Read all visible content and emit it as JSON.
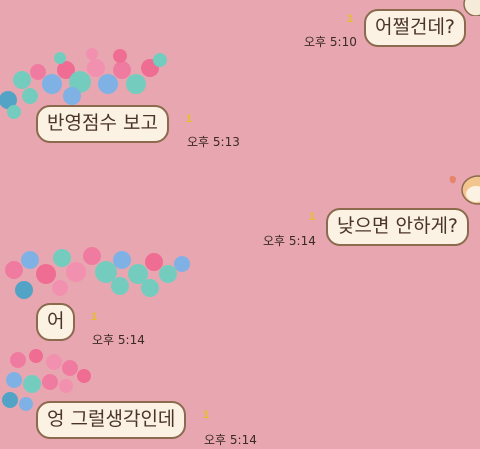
{
  "colors": {
    "background": "#e8a7b0",
    "bubble_fill": "#fbf2e4",
    "bubble_border": "#8b6a4e",
    "unread_count": "#e3c01f"
  },
  "messages": [
    {
      "side": "right",
      "text": "어쩔건데?",
      "unread": "1",
      "time": "오후 5:10"
    },
    {
      "side": "left",
      "text": "반영점수 보고",
      "unread": "1",
      "time": "오후 5:13"
    },
    {
      "side": "right",
      "text": "낮으면 안하게?",
      "unread": "1",
      "time": "오후 5:14"
    },
    {
      "side": "left",
      "text": "어",
      "unread": "1",
      "time": "오후 5:14"
    },
    {
      "side": "left",
      "text": "엉 그럴생각인데",
      "unread": "1",
      "time": "오후 5:14"
    }
  ],
  "decorations": {
    "paw_sticker_icon": "paw-prints-sticker-icon",
    "dog_sticker_icon": "dog-sticker-icon"
  }
}
